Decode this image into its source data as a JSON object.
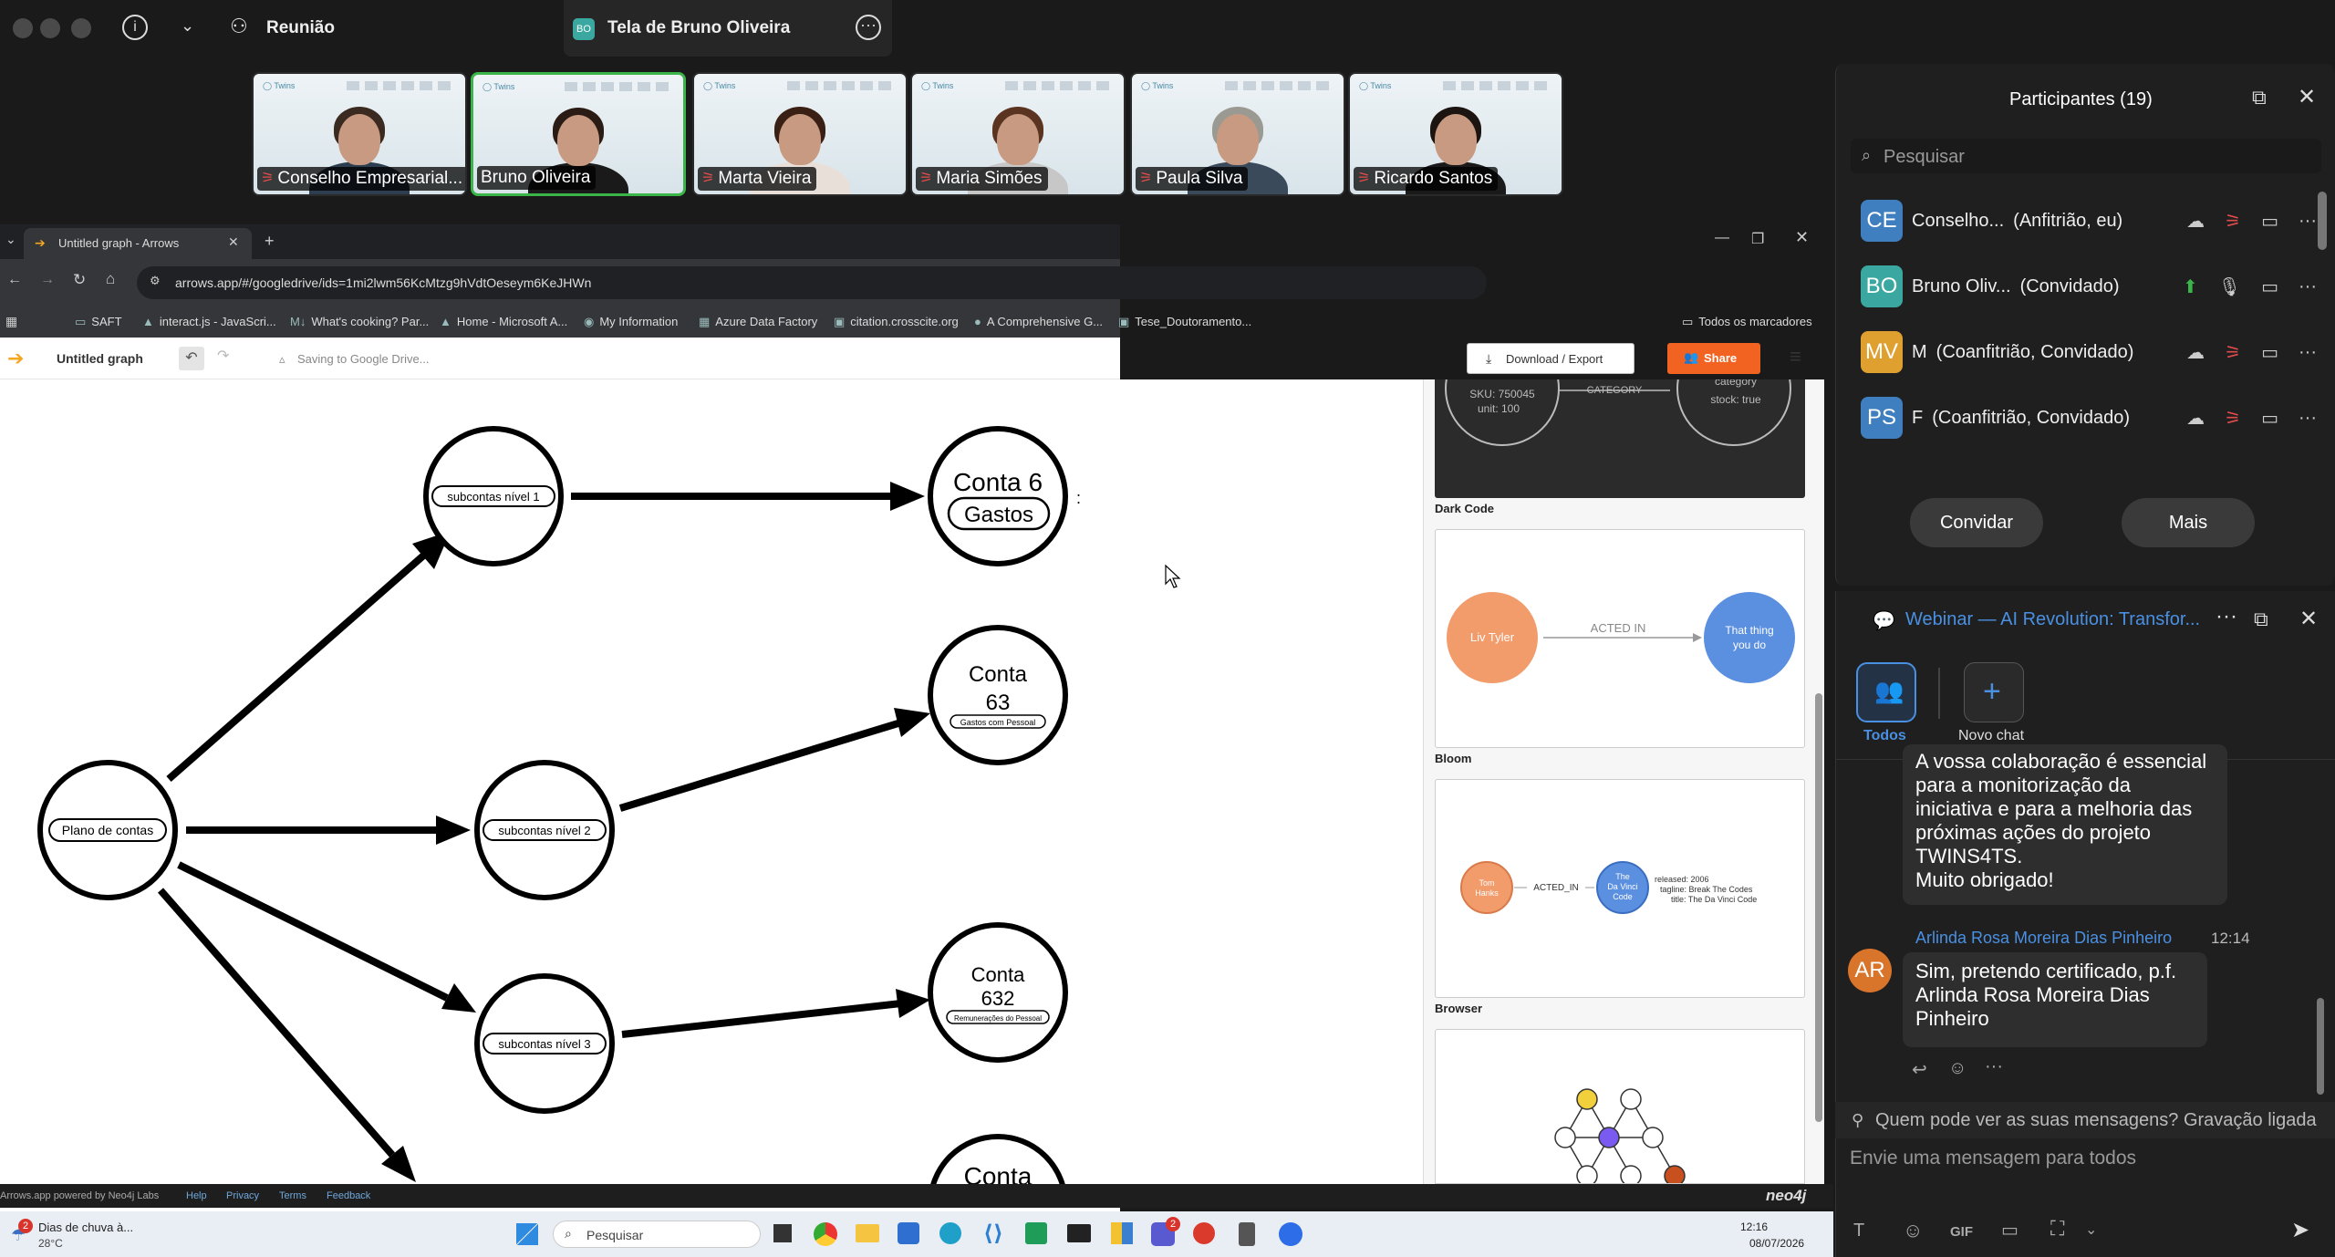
{
  "topbar": {
    "meeting_label": "Reunião",
    "share_title": "Tela de Bruno Oliveira",
    "share_initials": "BO"
  },
  "participants_strip": [
    {
      "name": "Conselho Empresarial...",
      "muted": true,
      "hair": "#3a2a20",
      "shirt": "#2c3e50"
    },
    {
      "name": "Bruno Oliveira",
      "muted": false,
      "hair": "#2a1c14",
      "shirt": "#1a1a1a",
      "active": true
    },
    {
      "name": "Marta Vieira",
      "muted": true,
      "hair": "#3a2014",
      "shirt": "#e8e0d8"
    },
    {
      "name": "Maria Simões",
      "muted": true,
      "hair": "#5a3420",
      "shirt": "#c7c7c7"
    },
    {
      "name": "Paula Silva",
      "muted": true,
      "hair": "#9a9a92",
      "shirt": "#3a4a5a"
    },
    {
      "name": "Ricardo Santos",
      "muted": true,
      "hair": "#1c1410",
      "shirt": "#1a1a1a"
    }
  ],
  "browser": {
    "tab_title": "Untitled graph - Arrows",
    "url": "arrows.app/#/googledrive/ids=1mi2lwm56KcMtzg9hVdtOeseym6KeJHWn",
    "bookmarks": [
      "SAFT",
      "interact.js - JavaScri...",
      "What's cooking? Par...",
      "Home - Microsoft A...",
      "My Information",
      "Azure Data Factory",
      "citation.crosscite.org",
      "A Comprehensive G...",
      "Tese_Doutoramento..."
    ],
    "all_bookmarks": "Todos os marcadores"
  },
  "arrows": {
    "graph_title": "Untitled graph",
    "saving_status": "Saving to Google Drive...",
    "download_label": "Download / Export",
    "share_label": "Share",
    "nodes": {
      "root": "Plano de contas",
      "sub1": "subcontas nível 1",
      "sub2": "subcontas nível 2",
      "sub3": "subcontas nível 3",
      "c6_title": "Conta 6",
      "c6_label": "Gastos",
      "c63_title": "Conta",
      "c63_num": "63",
      "c63_label": "Gastos com Pessoal",
      "c632_title": "Conta",
      "c632_num": "632",
      "c632_label": "Remunerações do Pessoal",
      "c_last": "Conta"
    },
    "styles": [
      {
        "name": "Dark Code"
      },
      {
        "name": "Bloom"
      },
      {
        "name": "Browser"
      }
    ],
    "darkcode": {
      "props": "SKU: 750045",
      "props2": "unit: 100",
      "rel": "CATEGORY",
      "right1": "category",
      "right2": "stock: true"
    },
    "bloom": {
      "left": "Liv Tyler",
      "rel": "ACTED IN",
      "right1": "That thing",
      "right2": "you do"
    },
    "browser_style": {
      "left1": "Tom",
      "left2": "Hanks",
      "rel": "ACTED_IN",
      "right1": "The",
      "right2": "Da Vinci",
      "right3": "Code",
      "p1": "released: 2006",
      "p2": "tagline: Break The Codes",
      "p3": "title: The Da Vinci Code"
    },
    "footer_links": [
      "Arrows.app powered by Neo4j Labs",
      "Help",
      "Privacy",
      "Terms",
      "Feedback"
    ],
    "neo4j": "neo4j"
  },
  "taskbar": {
    "weather_title": "Dias de chuva à...",
    "weather_temp": "28°C",
    "weather_badge": "2",
    "search_placeholder": "Pesquisar",
    "time": "12:16",
    "date": "08/07/2026",
    "teams_badge": "2"
  },
  "participants_panel": {
    "title": "Participantes (19)",
    "search_placeholder": "Pesquisar",
    "rows": [
      {
        "initials": "CE",
        "name": "Conselho...",
        "role": "(Anfitrião, eu)",
        "color": "#3f7fbf"
      },
      {
        "initials": "BO",
        "name": "Bruno Oliv...",
        "role": "(Convidado)",
        "color": "#3aa8a0"
      },
      {
        "initials": "MV",
        "name": "M",
        "role": "(Coanfitrião, Convidado)",
        "color": "#e0a030"
      },
      {
        "initials": "PS",
        "name": "F",
        "role": "(Coanfitrião, Convidado)",
        "color": "#3f7fbf"
      }
    ],
    "invite_label": "Convidar",
    "more_label": "Mais"
  },
  "chat": {
    "title": "Webinar — AI Revolution: Transfor...",
    "filter_all": "Todos",
    "new_chat": "Novo chat",
    "msg1_lines": [
      "A vossa colaboração é essencial",
      "para a monitorização da",
      "iniciativa e para a melhoria das",
      "próximas ações do projeto",
      "TWINS4TS.",
      "Muito obrigado!"
    ],
    "sender": "Arlinda Rosa Moreira Dias Pinheiro",
    "sender_time": "12:14",
    "sender_initials": "AR",
    "msg2_lines": [
      "Sim, pretendo certificado, p.f.",
      "Arlinda Rosa Moreira Dias",
      "Pinheiro"
    ],
    "visibility": "Quem pode ver as suas mensagens? Gravação ligada",
    "input_placeholder": "Envie uma mensagem para todos",
    "gif": "GIF"
  }
}
